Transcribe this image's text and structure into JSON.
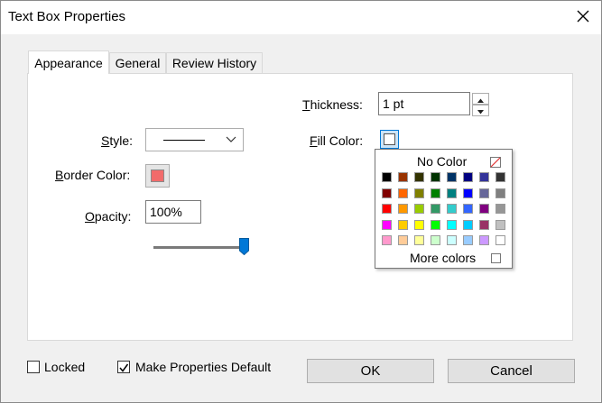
{
  "window": {
    "title": "Text Box Properties",
    "close_icon": "close-icon"
  },
  "tabs": [
    {
      "label": "Appearance",
      "active": true
    },
    {
      "label": "General",
      "active": false
    },
    {
      "label": "Review History",
      "active": false
    }
  ],
  "appearance": {
    "style_label": "Style:",
    "border_color_label": "Border Color:",
    "border_color": "#f26b6b",
    "opacity_label": "Opacity:",
    "opacity_value": "100%",
    "opacity_slider_fraction": 1.0,
    "thickness_label": "Thickness:",
    "thickness_value": "1 pt",
    "fill_color_label": "Fill Color:",
    "fill_color": "#ffffff"
  },
  "color_popup": {
    "no_color_label": "No Color",
    "more_colors_label": "More colors",
    "colors": [
      [
        "#000000",
        "#993300",
        "#333300",
        "#003300",
        "#003366",
        "#000080",
        "#333399",
        "#333333"
      ],
      [
        "#800000",
        "#ff6600",
        "#808000",
        "#008000",
        "#008080",
        "#0000ff",
        "#666699",
        "#808080"
      ],
      [
        "#ff0000",
        "#ff9900",
        "#99cc00",
        "#339966",
        "#33cccc",
        "#3366ff",
        "#800080",
        "#969696"
      ],
      [
        "#ff00ff",
        "#ffcc00",
        "#ffff00",
        "#00ff00",
        "#00ffff",
        "#00ccff",
        "#993366",
        "#c0c0c0"
      ],
      [
        "#ff99cc",
        "#ffcc99",
        "#ffff99",
        "#ccffcc",
        "#ccffff",
        "#99ccff",
        "#cc99ff",
        "#ffffff"
      ]
    ]
  },
  "footer": {
    "locked_label": "Locked",
    "locked_checked": false,
    "make_default_label": "Make Properties Default",
    "make_default_checked": true,
    "ok_label": "OK",
    "cancel_label": "Cancel"
  }
}
